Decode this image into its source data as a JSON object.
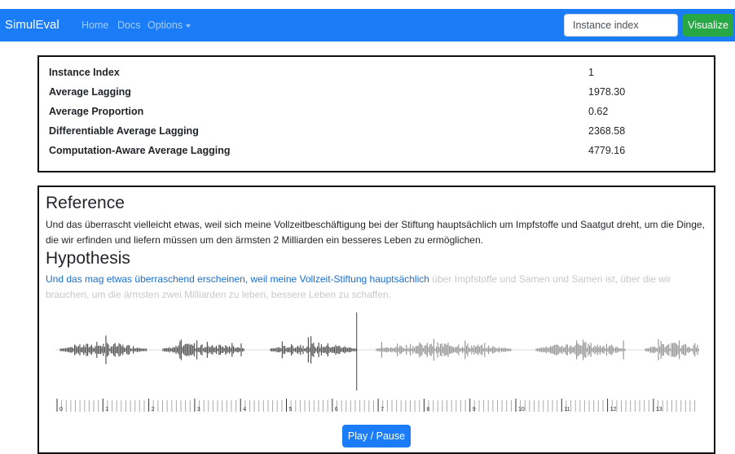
{
  "navbar": {
    "brand": "SimulEval",
    "links": [
      "Home",
      "Docs",
      "Options"
    ],
    "search_placeholder": "Instance index",
    "visualize_label": "Visualize"
  },
  "metrics": [
    {
      "name": "Instance Index",
      "value": "1"
    },
    {
      "name": "Average Lagging",
      "value": "1978.30"
    },
    {
      "name": "Average Proportion",
      "value": "0.62"
    },
    {
      "name": "Differentiable Average Lagging",
      "value": "2368.58"
    },
    {
      "name": "Computation-Aware Average Lagging",
      "value": "4779.16"
    }
  ],
  "reference": {
    "heading": "Reference",
    "text": "Und das überrascht vielleicht etwas, weil sich meine Vollzeitbeschäftigung bei der Stiftung hauptsächlich um Impfstoffe und Saatgut dreht, um die Dinge, die wir erfinden und liefern müssen um den ärmsten 2 Milliarden ein besseres Leben zu ermöglichen."
  },
  "hypothesis": {
    "heading": "Hypothesis",
    "text_played": "Und das mag etwas überraschend erscheinen, weil meine Vollzeit-Stiftung hauptsächlich",
    "text_remaining": "über Impfstoffe und Samen und Samen ist, über die wir brauchen, um die ärmsten zwei Milliarden zu leben, bessere Leben zu schaffen."
  },
  "waveform": {
    "playhead_fraction": 0.468,
    "played_color": "#555555",
    "unplayed_color": "#9a9a9a"
  },
  "timeline": {
    "labels": [
      "0",
      "1",
      "2",
      "3",
      "4",
      "5",
      "6",
      "7",
      "8",
      "9",
      "10",
      "11",
      "12",
      "13",
      "1"
    ]
  },
  "controls": {
    "play_pause_label": "Play / Pause"
  },
  "colors": {
    "navbar": "#1a7df7",
    "visualize": "#28a745",
    "hypothesis_played": "#1a6fd0",
    "hypothesis_remaining": "#c8c8c8"
  }
}
